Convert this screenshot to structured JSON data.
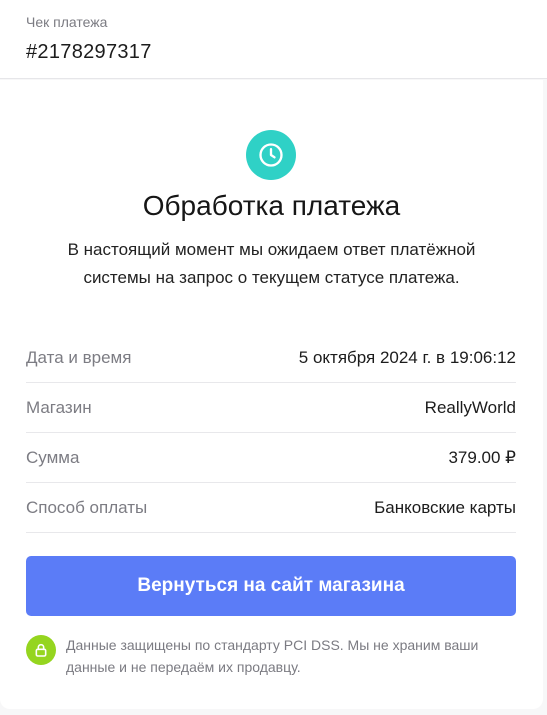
{
  "header": {
    "label": "Чек платежа",
    "number": "#2178297317"
  },
  "status": {
    "icon": "clock-icon",
    "icon_color": "#2fd1c6",
    "title": "Обработка платежа",
    "description": "В настоящий момент мы ожидаем ответ платёжной системы на запрос о текущем статусе платежа."
  },
  "details": [
    {
      "label": "Дата и время",
      "value": "5 октября 2024 г. в 19:06:12"
    },
    {
      "label": "Магазин",
      "value": "ReallyWorld"
    },
    {
      "label": "Сумма",
      "value": "379.00 ₽"
    },
    {
      "label": "Способ оплаты",
      "value": "Банковские карты"
    }
  ],
  "back_button": {
    "label": "Вернуться на сайт магазина",
    "color": "#5b7cf7"
  },
  "security": {
    "icon": "lock-icon",
    "icon_color": "#95d51f",
    "text": "Данные защищены по стандарту PCI DSS. Мы не храним ваши данные и не передаём их продавцу."
  }
}
